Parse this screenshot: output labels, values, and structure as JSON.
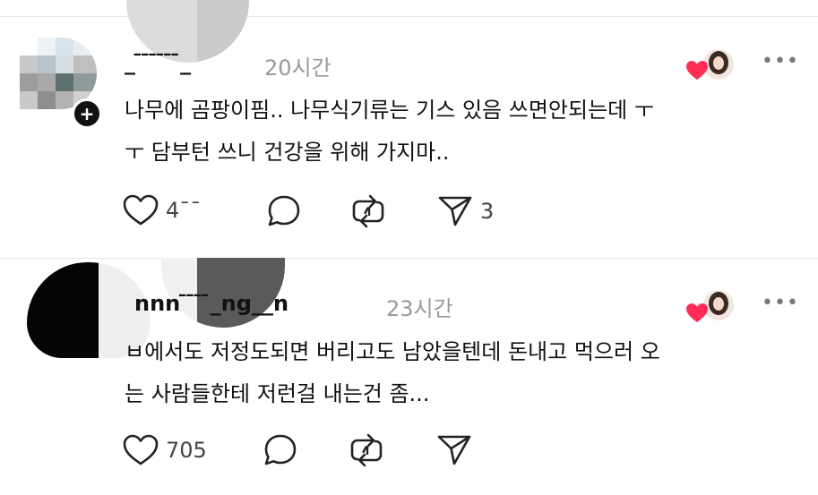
{
  "posts": [
    {
      "username": "_ ̄ ̄ ̄ ̄ ̄ ̄_",
      "time": "20시간",
      "text_line1": "나무에 곰팡이핌.. 나무식기류는 기스 있음 쓰면안되는데 ㅜ",
      "text_line2": "ㅜ 담부턴 쓰니 건강을 위해 가지마..",
      "likes": "4¯¯",
      "reposts_count": "3"
    },
    {
      "username": "nnn  ̄ ̄ ̄ ̄_ng__n",
      "time": "23시간",
      "text_line1": "ㅂ에서도 저정도되면 버리고도 남았을텐데 돈내고 먹으러 오",
      "text_line2": "는 사람들한테 저런걸 내는건 좀...",
      "likes": "705",
      "reposts_count": ""
    }
  ],
  "icons": {
    "like": "heart-outline-icon",
    "reply": "speech-bubble-icon",
    "repost": "repost-arrows-icon",
    "share": "paper-plane-icon",
    "more": "more-dots-icon"
  },
  "colors": {
    "heart": "#ff2d55",
    "muted": "#9a9a9a",
    "icon": "#222222"
  }
}
